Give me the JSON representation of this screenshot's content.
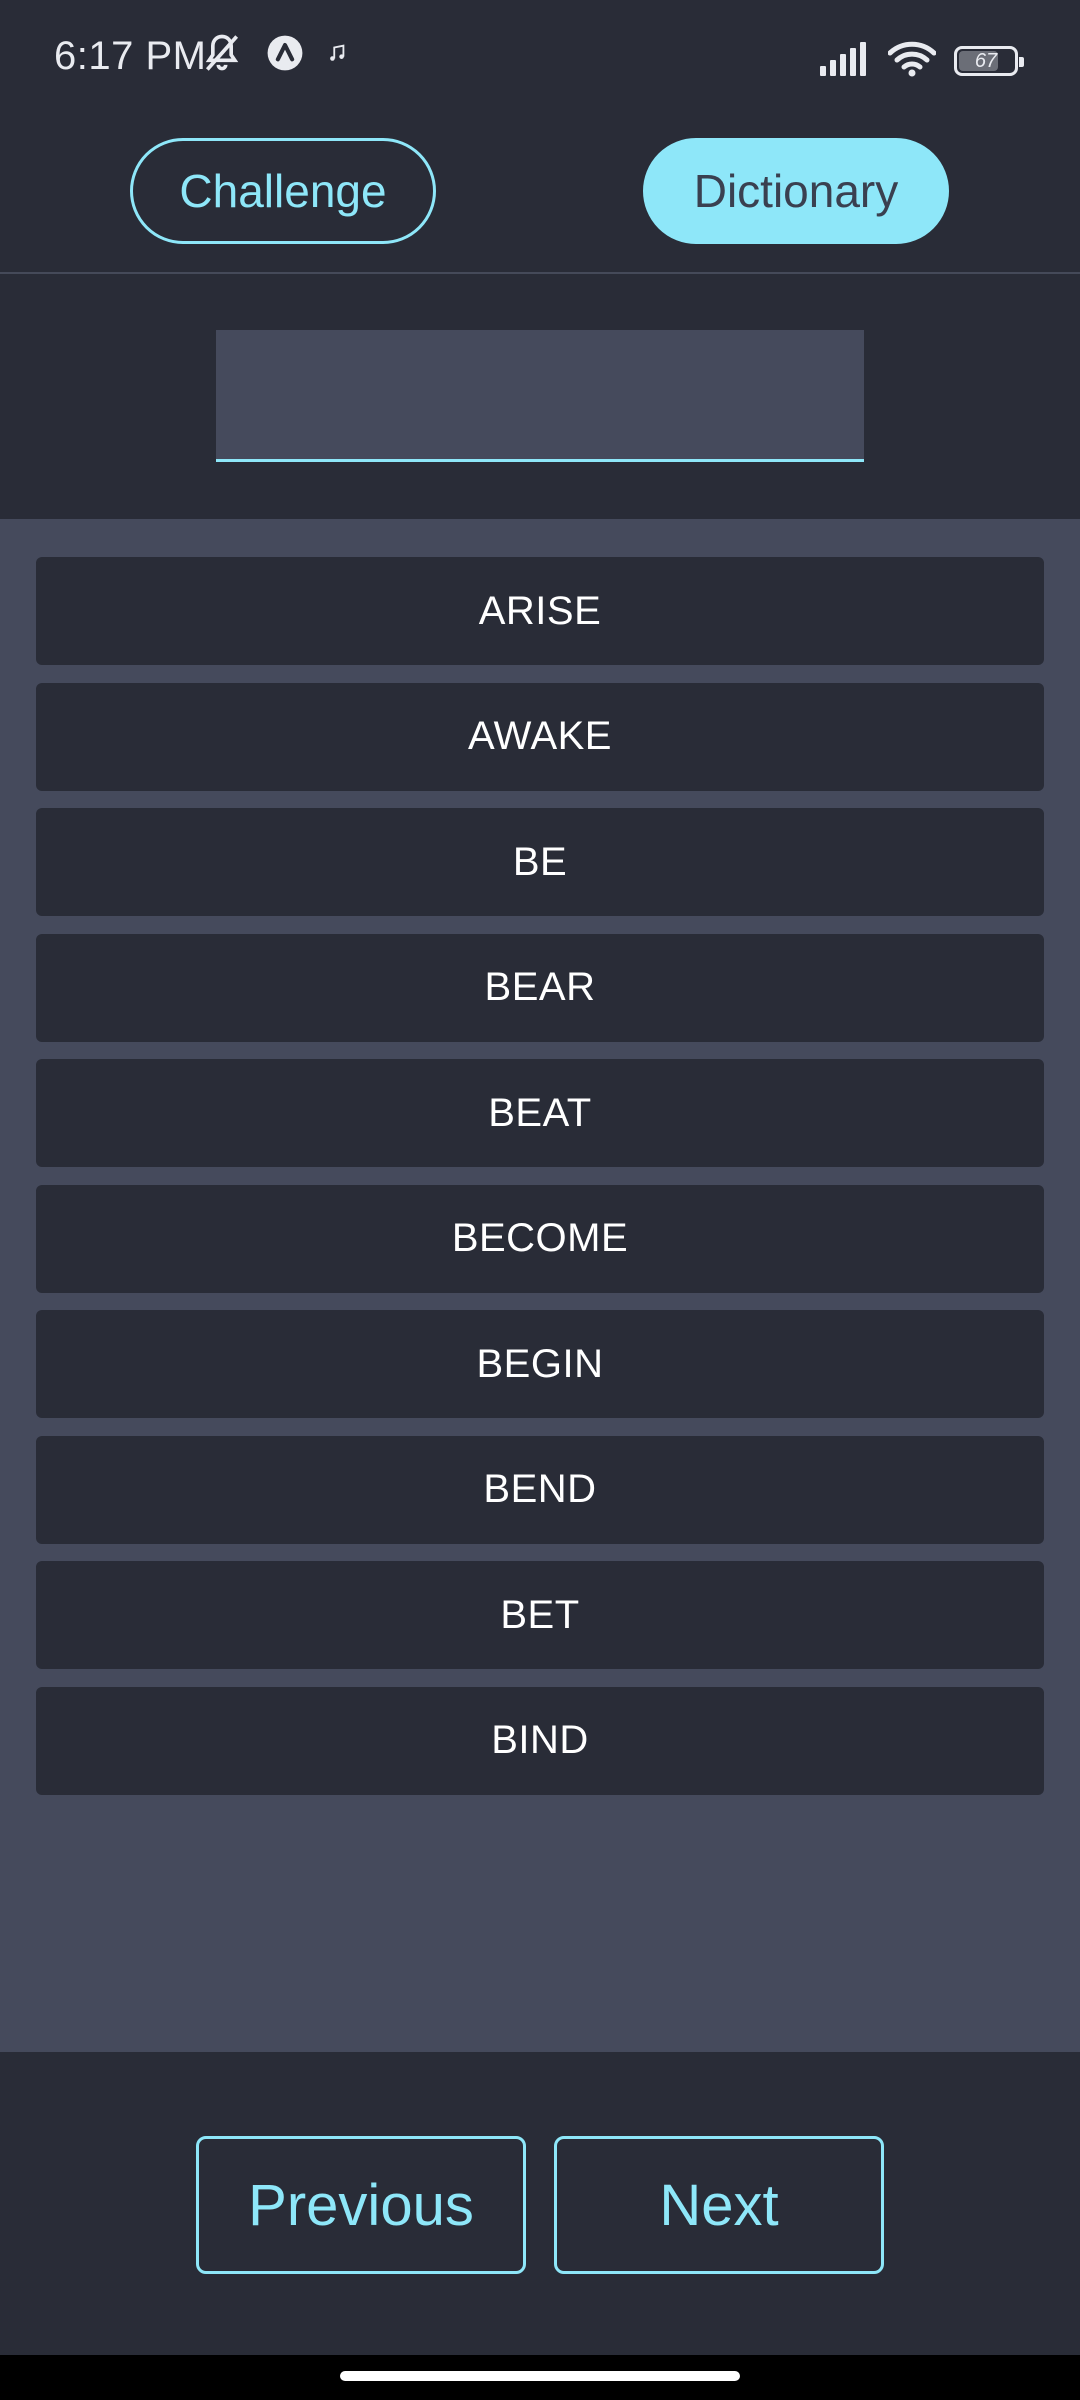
{
  "status_bar": {
    "time": "6:17 PM",
    "battery_level": "67",
    "left_icons": [
      "bell-off-icon",
      "app-notification-icon",
      "music-note-icon"
    ],
    "right_icons": [
      "signal-icon",
      "wifi-icon",
      "battery-icon"
    ]
  },
  "tabs": {
    "challenge_label": "Challenge",
    "dictionary_label": "Dictionary",
    "active": "Dictionary"
  },
  "search": {
    "value": "",
    "placeholder": ""
  },
  "words": [
    "ARISE",
    "AWAKE",
    "BE",
    "BEAR",
    "BEAT",
    "BECOME",
    "BEGIN",
    "BEND",
    "BET",
    "BIND"
  ],
  "navigation": {
    "previous_label": "Previous",
    "next_label": "Next"
  },
  "colors": {
    "accent": "#8ee7f9",
    "background_dark": "#292c37",
    "background_panel": "#454a5c",
    "text": "#ffffff"
  }
}
